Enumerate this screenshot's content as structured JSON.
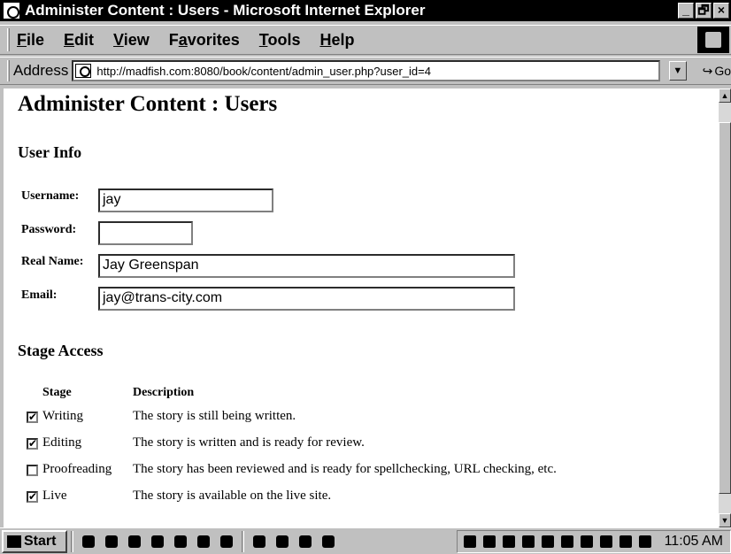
{
  "window": {
    "title": "Administer Content : Users - Microsoft Internet Explorer",
    "controls": [
      "_",
      "🗗",
      "×"
    ]
  },
  "menu": {
    "items": [
      {
        "accel": "F",
        "rest": "ile"
      },
      {
        "accel": "E",
        "rest": "dit"
      },
      {
        "accel": "V",
        "rest": "iew"
      },
      {
        "pre": "F",
        "accel": "a",
        "rest": "vorites"
      },
      {
        "accel": "T",
        "rest": "ools"
      },
      {
        "accel": "H",
        "rest": "elp"
      }
    ]
  },
  "address": {
    "label": "Address",
    "url": "http://madfish.com:8080/book/content/admin_user.php?user_id=4",
    "go": "Go"
  },
  "page": {
    "title": "Administer Content : Users",
    "user_info_heading": "User Info",
    "fields": {
      "username_label": "Username:",
      "username_value": "jay",
      "password_label": "Password:",
      "password_value": "",
      "realname_label": "Real Name:",
      "realname_value": "Jay Greenspan",
      "email_label": "Email:",
      "email_value": "jay@trans-city.com"
    },
    "stage_access_heading": "Stage Access",
    "table_headers": {
      "stage": "Stage",
      "description": "Description"
    },
    "stages": [
      {
        "name": "Writing",
        "description": "The story is still being written.",
        "checked": true
      },
      {
        "name": "Editing",
        "description": "The story is written and is ready for review.",
        "checked": true
      },
      {
        "name": "Proofreading",
        "description": "The story has been reviewed and is ready for spellchecking, URL checking, etc.",
        "checked": false
      },
      {
        "name": "Live",
        "description": "The story is available on the live site.",
        "checked": true
      }
    ]
  },
  "taskbar": {
    "start": "Start",
    "clock": "11:05 AM"
  }
}
